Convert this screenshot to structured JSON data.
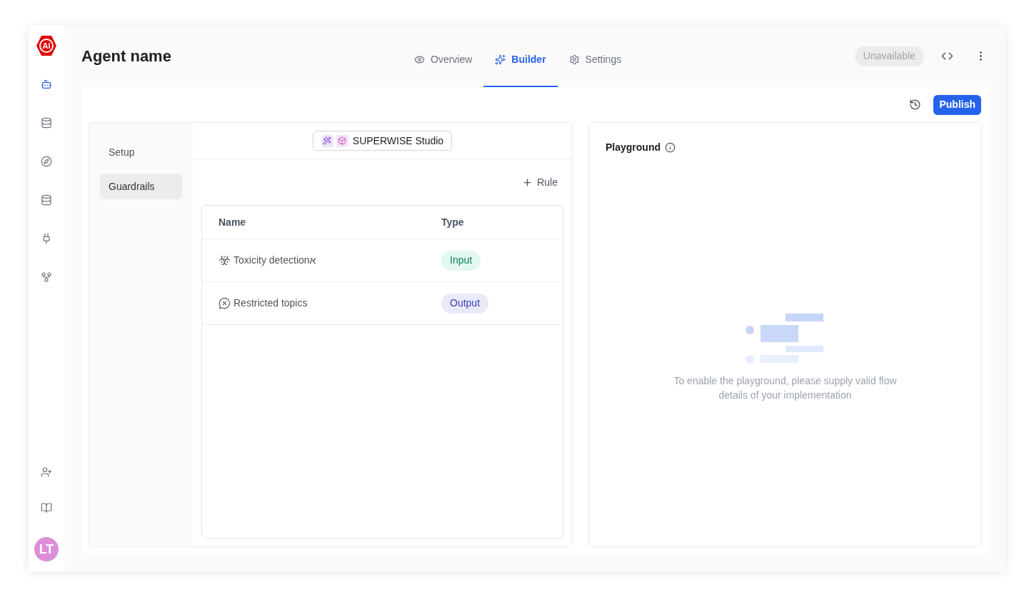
{
  "logo": {
    "text": "AI"
  },
  "sidebar": {
    "items": [
      {
        "selected": true
      },
      {
        "selected": false
      },
      {
        "selected": false
      },
      {
        "selected": false
      },
      {
        "selected": false
      },
      {
        "selected": false
      }
    ],
    "avatar": {
      "initials": "LT"
    }
  },
  "header": {
    "title": "Agent name",
    "tabs": [
      {
        "label": "Overview",
        "selected": false
      },
      {
        "label": "Builder",
        "selected": true
      },
      {
        "label": "Settings",
        "selected": false
      }
    ],
    "status": {
      "label": "Unavailable",
      "disabled": true
    }
  },
  "toolbar": {
    "publish": "Publish"
  },
  "builder_nav": [
    {
      "label": "Setup",
      "selected": false
    },
    {
      "label": "Guardrails",
      "selected": true
    }
  ],
  "studio_chip": {
    "label": "SUPERWISE Studio"
  },
  "add_rule": "Rule",
  "table": {
    "columns": [
      "Name",
      "Type"
    ],
    "rows": [
      {
        "name": "Toxicity detectionא",
        "type": {
          "label": "Input",
          "kind": "input"
        }
      },
      {
        "name": "Restricted topics",
        "type": {
          "label": "Output",
          "kind": "output"
        }
      }
    ]
  },
  "playground": {
    "title": "Playground",
    "message": "To enable the playground, please supply valid flow details of your implementation"
  }
}
